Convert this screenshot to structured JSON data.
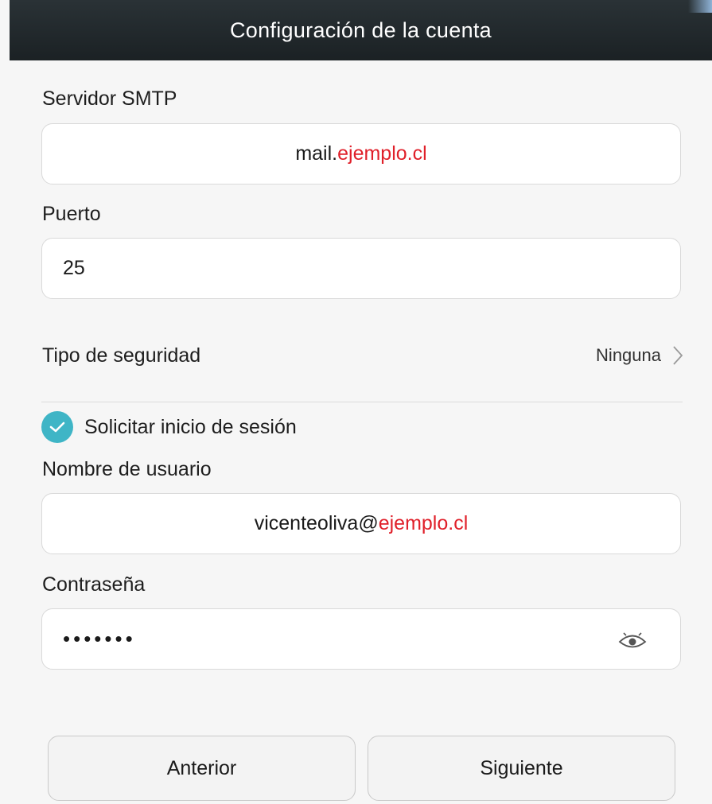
{
  "header": {
    "title": "Configuración de la cuenta"
  },
  "smtp": {
    "label": "Servidor SMTP",
    "value_prefix": "mail.",
    "value_domain": "ejemplo.cl"
  },
  "port": {
    "label": "Puerto",
    "value": "25"
  },
  "security": {
    "label": "Tipo de seguridad",
    "value": "Ninguna"
  },
  "login_required": {
    "label": "Solicitar inicio de sesión",
    "checked": true
  },
  "username": {
    "label": "Nombre de usuario",
    "value_prefix": "vicenteoliva@",
    "value_domain": "ejemplo.cl"
  },
  "password": {
    "label": "Contraseña",
    "masked": "•••••••"
  },
  "buttons": {
    "previous": "Anterior",
    "next": "Siguiente"
  },
  "colors": {
    "accent": "#3fb5c6",
    "highlight": "#e0202a",
    "header_bg": "#1f2629"
  },
  "icons": {
    "chevron": "chevron-right-icon",
    "eye": "eye-icon",
    "check": "check-icon"
  }
}
